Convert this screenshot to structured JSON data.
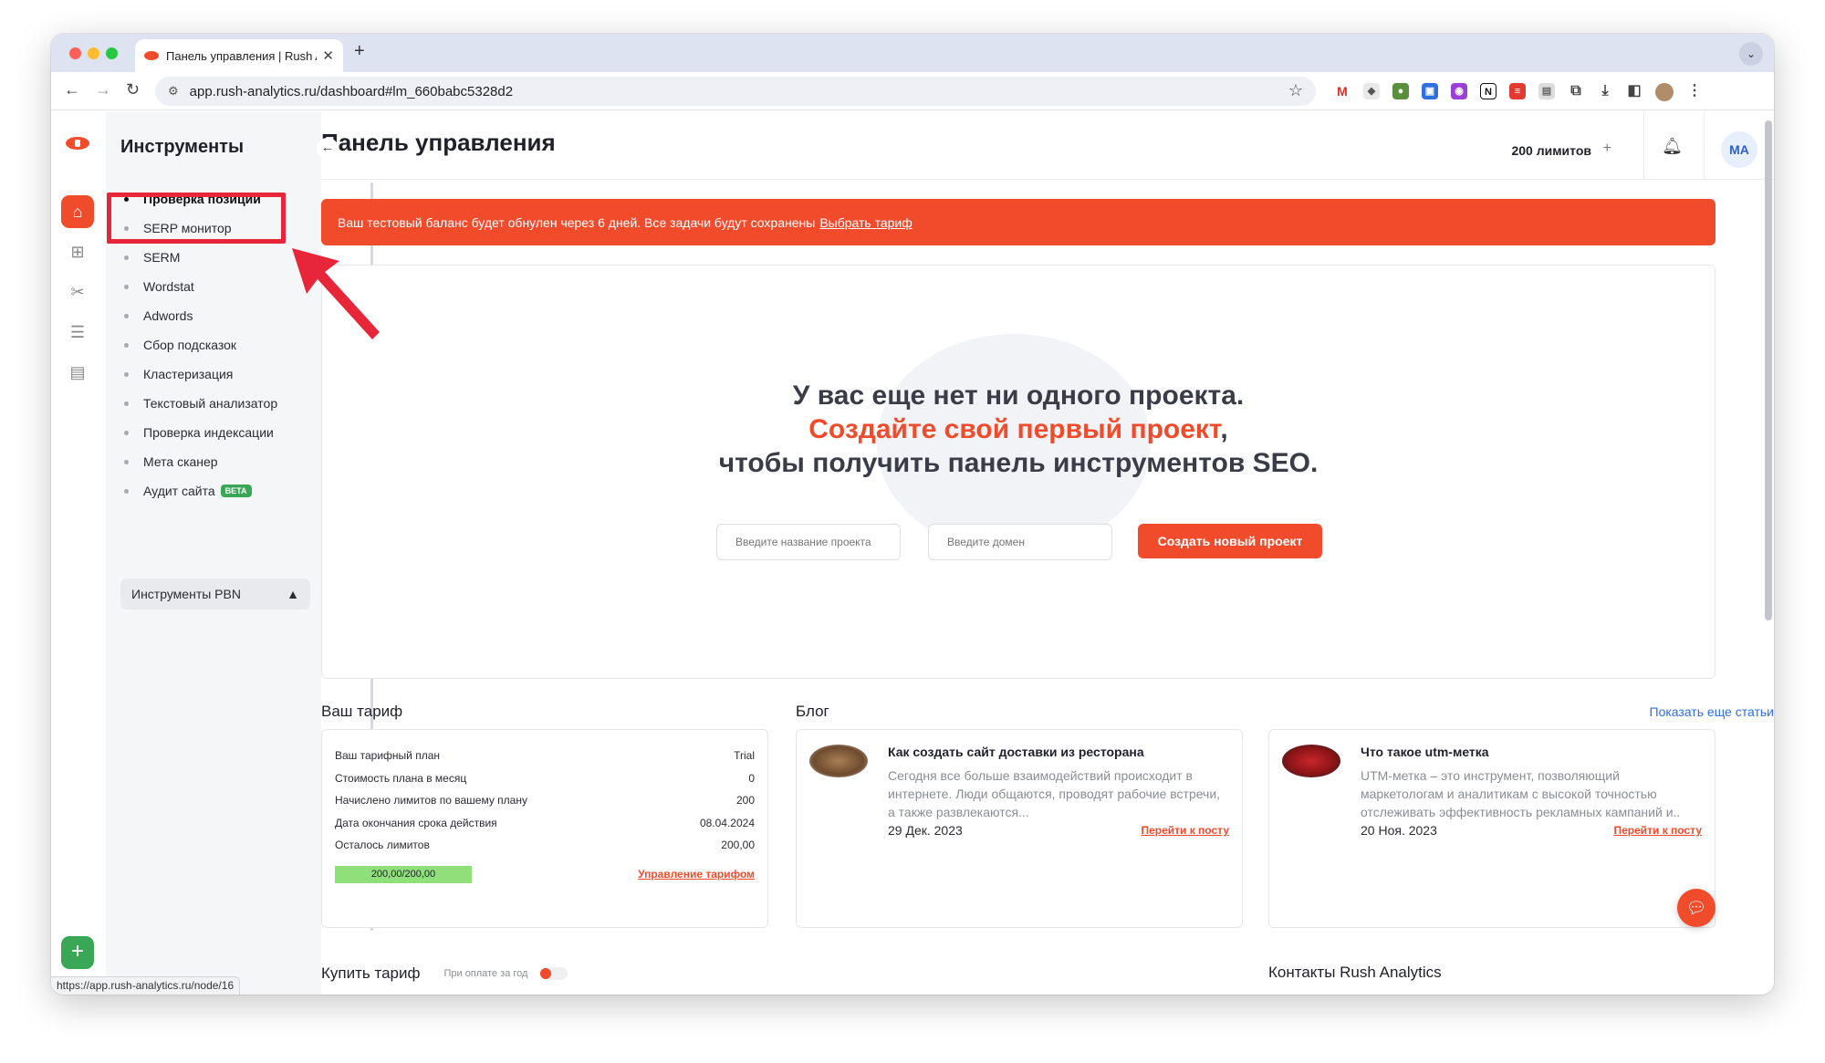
{
  "browser": {
    "tab_title": "Панель управления | Rush Analytics",
    "tab_close": "✕",
    "new_tab": "+",
    "url": "app.rush-analytics.ru/dashboard#lm_660babc5328d2",
    "status_url": "https://app.rush-analytics.ru/node/16"
  },
  "sidebar": {
    "title": "Инструменты",
    "collapse_icon": "←",
    "items": [
      {
        "label": "Проверка позиций",
        "active": true
      },
      {
        "label": "SERP монитор"
      },
      {
        "label": "SERM"
      },
      {
        "label": "Wordstat"
      },
      {
        "label": "Adwords"
      },
      {
        "label": "Сбор подсказок"
      },
      {
        "label": "Кластеризация"
      },
      {
        "label": "Текстовый анализатор"
      },
      {
        "label": "Проверка индексации"
      },
      {
        "label": "Мета сканер"
      },
      {
        "label": "Аудит сайта",
        "badge": "BETA"
      }
    ],
    "pbn_label": "Инструменты PBN"
  },
  "header": {
    "title": "Панель управления",
    "limits": "200 лимитов",
    "user_initials": "MA"
  },
  "alert": {
    "text": "Ваш тестовый баланс будет обнулен через 6 дней. Все задачи будут сохранены",
    "link": "Выбрать тариф"
  },
  "empty": {
    "line1": "У вас еще нет ни одного проекта.",
    "line2": "Создайте свой первый проект",
    "line2_suffix": ",",
    "line3": "чтобы получить панель инструментов SEO.",
    "project_placeholder": "Введите название проекта",
    "domain_placeholder": "Введите домен",
    "create_button": "Создать новый проект"
  },
  "tariff": {
    "title": "Ваш тариф",
    "rows": [
      {
        "label": "Ваш тарифный план",
        "value": "Trial"
      },
      {
        "label": "Стоимость плана в месяц",
        "value": "0"
      },
      {
        "label": "Начислено лимитов по вашему плану",
        "value": "200"
      },
      {
        "label": "Дата окончания срока действия",
        "value": "08.04.2024"
      },
      {
        "label": "Осталось лимитов",
        "value": "200,00"
      }
    ],
    "progress_text": "200,00/200,00",
    "progress_fraction": 1.0,
    "manage_link": "Управление тарифом"
  },
  "blog": {
    "title": "Блог",
    "more_link": "Показать еще статьи",
    "posts": [
      {
        "title": "Как создать сайт доставки из ресторана",
        "text": "Сегодня все больше взаимодействий происходит в интернете. Люди общаются, проводят рабочие встречи, а также развлекаются...",
        "date": "29 Дек. 2023",
        "link": "Перейти к посту"
      },
      {
        "title": "Что такое utm-метка",
        "text": "UTM-метка – это инструмент, позволяющий маркетологам и аналитикам с высокой точностью отслеживать эффективность рекламных кампаний и..",
        "date": "20 Ноя. 2023",
        "link": "Перейти к посту"
      }
    ]
  },
  "buy": {
    "title": "Купить тариф",
    "yearly_label": "При оплате за год"
  },
  "contacts": {
    "title": "Контакты Rush Analytics"
  }
}
